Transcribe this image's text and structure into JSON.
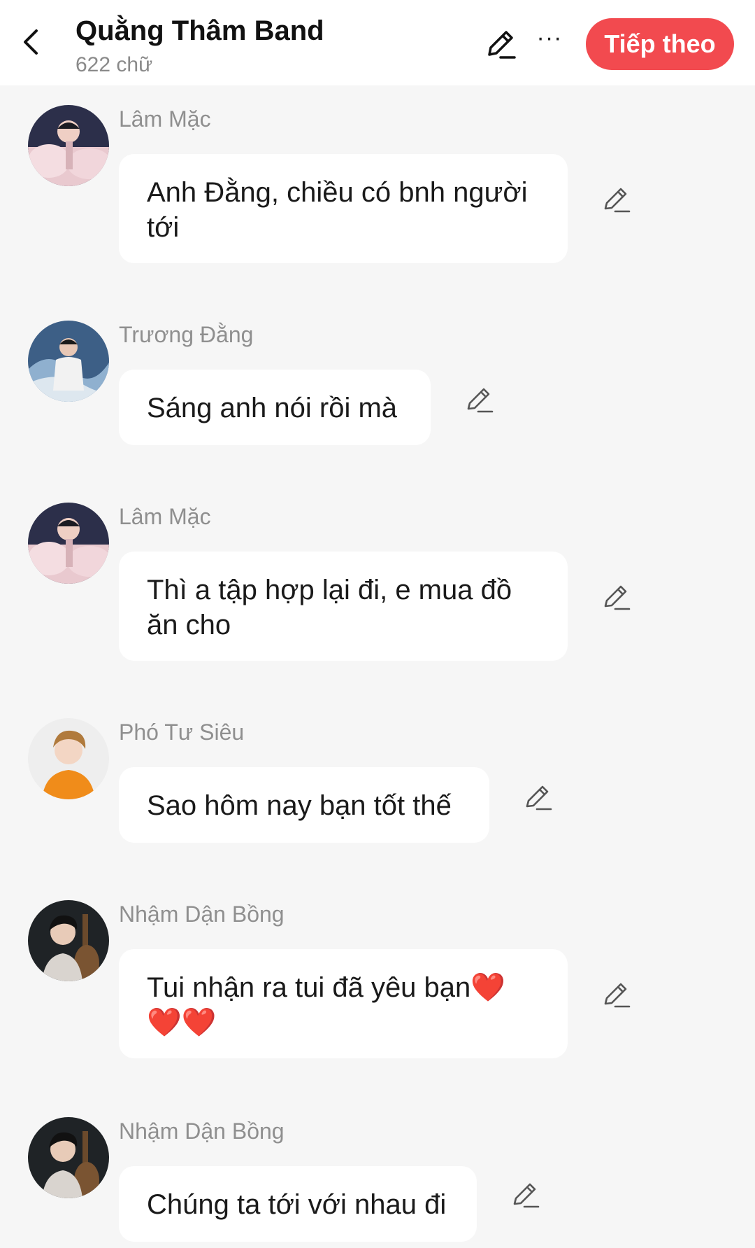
{
  "header": {
    "title": "Quằng Thâm Band",
    "word_count": "622 chữ",
    "more_label": "···",
    "next_label": "Tiếp theo",
    "accent_color": "#f24a4f"
  },
  "icons": {
    "back": "chevron-left-icon",
    "edit": "pencil-icon",
    "more": "more-horizontal-icon"
  },
  "messages": [
    {
      "name": "Lâm Mặc",
      "text_line1": "Anh Đằng, chiều có bnh người",
      "text_line2": "tới"
    },
    {
      "name": "Trương Đằng",
      "text_line1": "Sáng anh nói rồi mà"
    },
    {
      "name": "Lâm Mặc",
      "text_line1": "Thì a tập hợp lại đi, e mua đồ",
      "text_line2": "ăn cho"
    },
    {
      "name": "Phó Tư Siêu",
      "text_line1": "Sao hôm nay bạn tốt thế"
    },
    {
      "name": "Nhậm Dận Bồng",
      "text_line1": "Tui nhận ra tui đã yêu bạn",
      "hearts_line1": "❤️",
      "hearts_line2": "❤️❤️"
    },
    {
      "name": "Nhậm Dận Bồng",
      "text_line1": "Chúng ta tới với nhau đi"
    }
  ]
}
